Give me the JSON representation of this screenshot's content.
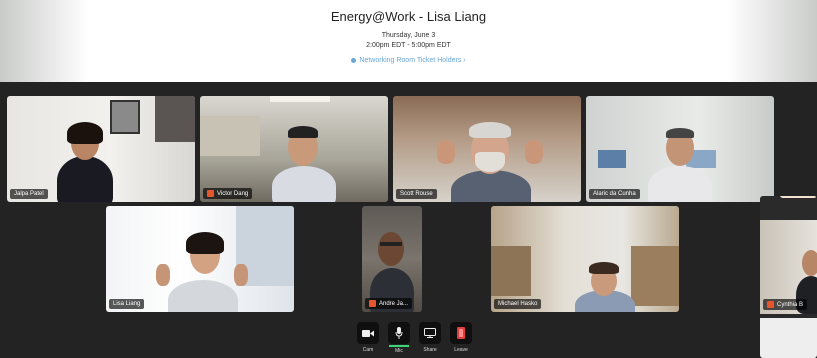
{
  "event": {
    "title": "Energy@Work - Lisa Liang",
    "date": "Thursday, June 3",
    "time": "2:00pm EDT - 5:00pm EDT",
    "link": "Networking Room Ticket Holders ›"
  },
  "participants": [
    {
      "name": "Jalpa Patel",
      "muted": false
    },
    {
      "name": "Victor Dang",
      "muted": true
    },
    {
      "name": "Scott Rouse",
      "muted": false
    },
    {
      "name": "Alaric da Cunha",
      "muted": false
    },
    {
      "name": "Lisa Liang",
      "muted": false
    },
    {
      "name": "Andre Ja...",
      "muted": true
    },
    {
      "name": "Michael Hasko",
      "muted": false
    },
    {
      "name": "Cynthia B",
      "muted": true
    }
  ],
  "controls": {
    "cam": "Cam",
    "mic": "Mic",
    "share": "Share",
    "leave": "Leave"
  },
  "colors": {
    "mic_active": "#3dd17c",
    "muted": "#e4572e",
    "leave": "#e23b3b"
  }
}
